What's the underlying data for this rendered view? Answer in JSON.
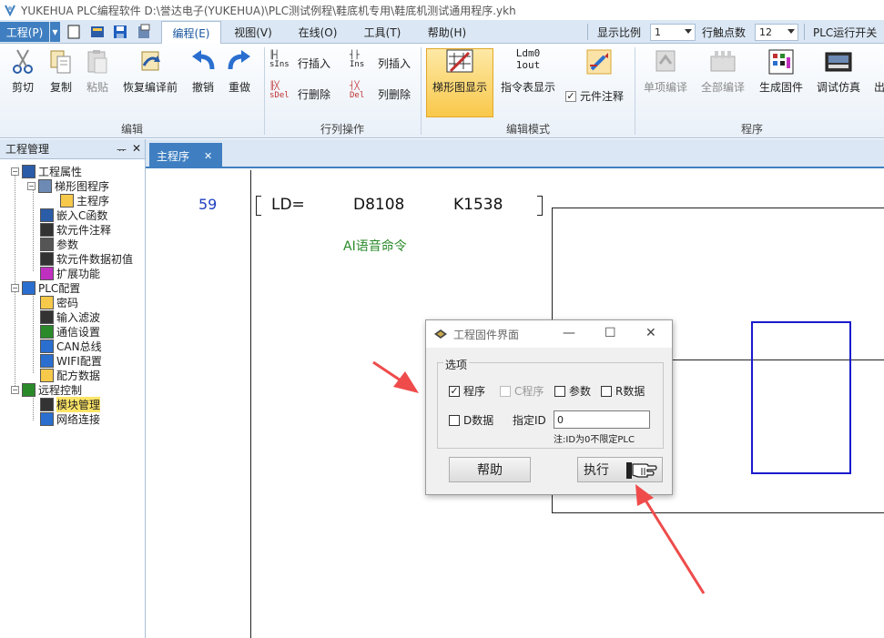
{
  "window": {
    "title": "YUKEHUA PLC编程软件 D:\\誉达电子(YUKEHUA)\\PLC测试例程\\鞋底机专用\\鞋底机测试通用程序.ykh"
  },
  "menu": {
    "file": "工程(P)",
    "tabs": [
      "编程(E)",
      "视图(V)",
      "在线(O)",
      "工具(T)",
      "帮助(H)"
    ],
    "display_ratio_label": "显示比例",
    "display_ratio_value": "1",
    "row_contacts_label": "行触点数",
    "row_contacts_value": "12",
    "plc_run_switch": "PLC运行开关"
  },
  "ribbon": {
    "edit_group": {
      "label": "编辑",
      "cut": "剪切",
      "copy": "复制",
      "paste": "粘贴",
      "restore": "恢复编译前",
      "undo": "撤销",
      "redo": "重做"
    },
    "row_col_group": {
      "label": "行列操作",
      "row_insert_icon": "sIns",
      "row_insert": "行插入",
      "row_delete_icon": "sDel",
      "row_delete": "行删除",
      "col_insert_icon": "Ins",
      "col_insert": "列插入",
      "col_delete_icon": "Del",
      "col_delete": "列删除"
    },
    "edit_mode_group": {
      "label": "编辑模式",
      "ladder_view": "梯形图显示",
      "instr_icon_line1": "Ldm0",
      "instr_icon_line2": "1out",
      "instruction_view": "指令表显示",
      "element_comment": "元件注释",
      "element_comment_checked": true
    },
    "program_group": {
      "label": "程序",
      "single_compile": "单项编译",
      "full_compile": "全部编译",
      "generate_firmware": "生成固件",
      "debug_sim": "调试仿真",
      "cut_off": "出"
    }
  },
  "project_panel": {
    "title": "工程管理",
    "pin": "ᅲ",
    "close": "✕",
    "items": [
      {
        "label": "工程属性",
        "icon": "project-properties-icon"
      },
      {
        "label": "梯形图程序",
        "icon": "ladder-program-icon"
      },
      {
        "label": "主程序",
        "icon": "folder-icon"
      },
      {
        "label": "嵌入C函数",
        "icon": "c-function-icon"
      },
      {
        "label": "软元件注释",
        "icon": "element-comment-icon"
      },
      {
        "label": "参数",
        "icon": "parameters-icon"
      },
      {
        "label": "软元件数据初值",
        "icon": "element-initial-data-icon"
      },
      {
        "label": "扩展功能",
        "icon": "extension-icon"
      },
      {
        "label": "PLC配置",
        "icon": "wrench-icon"
      },
      {
        "label": "密码",
        "icon": "lock-icon"
      },
      {
        "label": "输入滤波",
        "icon": "input-filter-icon"
      },
      {
        "label": "通信设置",
        "icon": "communication-icon"
      },
      {
        "label": "CAN总线",
        "icon": "can-bus-icon"
      },
      {
        "label": "WIFI配置",
        "icon": "wifi-icon"
      },
      {
        "label": "配方数据",
        "icon": "recipe-folder-icon"
      },
      {
        "label": "远程控制",
        "icon": "remote-control-icon"
      },
      {
        "label": "模块管理",
        "icon": "module-icon"
      },
      {
        "label": "网络连接",
        "icon": "network-icon"
      }
    ]
  },
  "editor": {
    "tab_label": "主程序",
    "tab_close": "✕",
    "rung_number": "59",
    "instruction": "LD=",
    "operand1": "D8108",
    "operand2": "K1538",
    "comment": "AI语音命令"
  },
  "dialog": {
    "title": "工程固件界面",
    "minimize": "—",
    "maximize": "☐",
    "close": "✕",
    "options_legend": "选项",
    "opt_program": "程序",
    "opt_program_checked": true,
    "opt_c_program": "C程序",
    "opt_params": "参数",
    "opt_r_data": "R数据",
    "opt_d_data": "D数据",
    "specify_id_label": "指定ID",
    "specify_id_value": "0",
    "note": "注:ID为0不限定PLC",
    "help_button": "帮助",
    "execute_button": "执行"
  }
}
